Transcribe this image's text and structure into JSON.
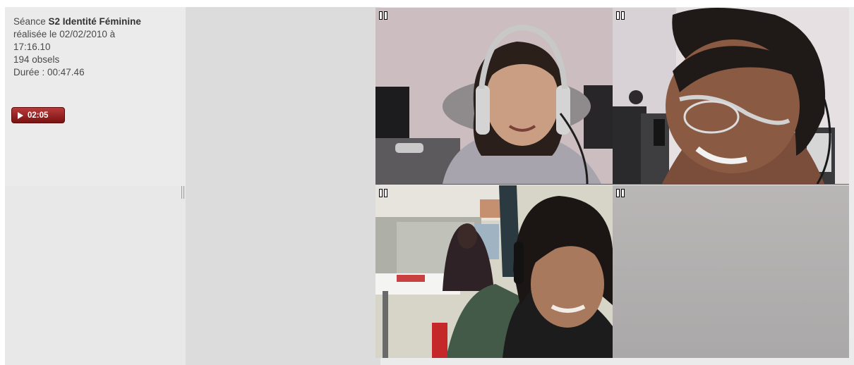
{
  "session": {
    "prefix": "Séance ",
    "name": "S2 Identité Féminine",
    "line2": "réalisée le 02/02/2010 à",
    "line3": "17:16.10",
    "obsels": "194 obsels",
    "duration": "Durée : 00:47.46"
  },
  "player": {
    "play_label": "02:05"
  },
  "videos": [
    {
      "id": "video-1",
      "icon": "pause-icon"
    },
    {
      "id": "video-2",
      "icon": "pause-icon"
    },
    {
      "id": "video-3",
      "icon": "pause-icon"
    },
    {
      "id": "video-4",
      "icon": "pause-icon"
    }
  ],
  "colors": {
    "panel_bg": "#ebebeb",
    "middle_bg": "#dcdcdc",
    "play_button": "#9a2323",
    "accent_line": "#a63838"
  }
}
